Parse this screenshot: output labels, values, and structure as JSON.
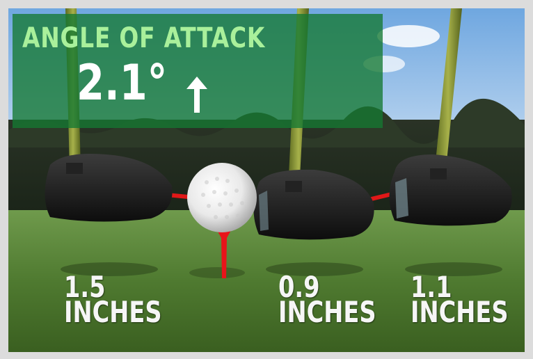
{
  "overlay": {
    "title": "ANGLE OF ATTACK",
    "value": "2.1°",
    "direction_icon": "up-arrow-icon"
  },
  "distances": [
    {
      "value": "1.5",
      "unit": "INCHES"
    },
    {
      "value": "0.9",
      "unit": "INCHES"
    },
    {
      "value": "1.1",
      "unit": "INCHES"
    }
  ],
  "colors": {
    "panel_green": "#14783a",
    "title_green": "#a9f09b",
    "tee_red": "#e8141a",
    "connector_red": "#e01818"
  }
}
